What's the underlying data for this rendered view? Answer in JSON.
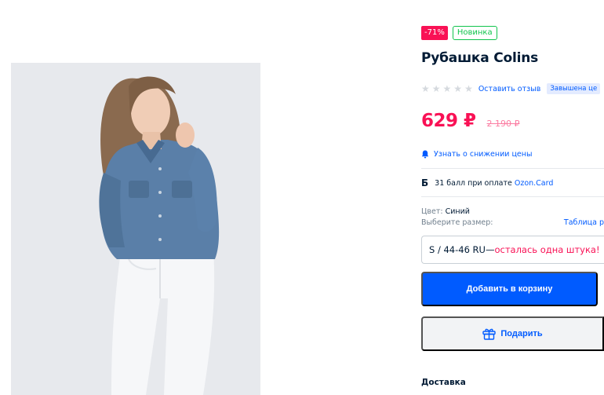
{
  "product": {
    "discount_badge": "-71%",
    "new_badge": "Новинка",
    "title": "Рубашка Colins",
    "rating_stars": 0,
    "review_link": "Оставить отзыв",
    "overpriced_badge": "Завышена це",
    "price": "629 ₽",
    "old_price": "2 190 ₽",
    "price_notify": "Узнать о снижении цены",
    "points_icon": "Б",
    "points_text": "31 балл при оплате ",
    "points_link": "Ozon.Card",
    "color_label": "Цвет: ",
    "color_value": "Синий",
    "size_prompt": "Выберите размер:",
    "size_table_link": "Таблица р",
    "selected_size": "S / 44-46 RU",
    "size_dash": " — ",
    "size_warning": "осталась одна штука!",
    "add_to_cart": "Добавить в корзину",
    "gift_button": "Подарить",
    "delivery_heading": "Доставка"
  },
  "icons": {
    "bell": "bell-icon",
    "gift": "gift-icon",
    "star": "star-icon"
  },
  "colors": {
    "accent": "#005bff",
    "sale": "#f91155",
    "new": "#10c44c",
    "text": "#001a34",
    "muted": "#707f8d"
  }
}
